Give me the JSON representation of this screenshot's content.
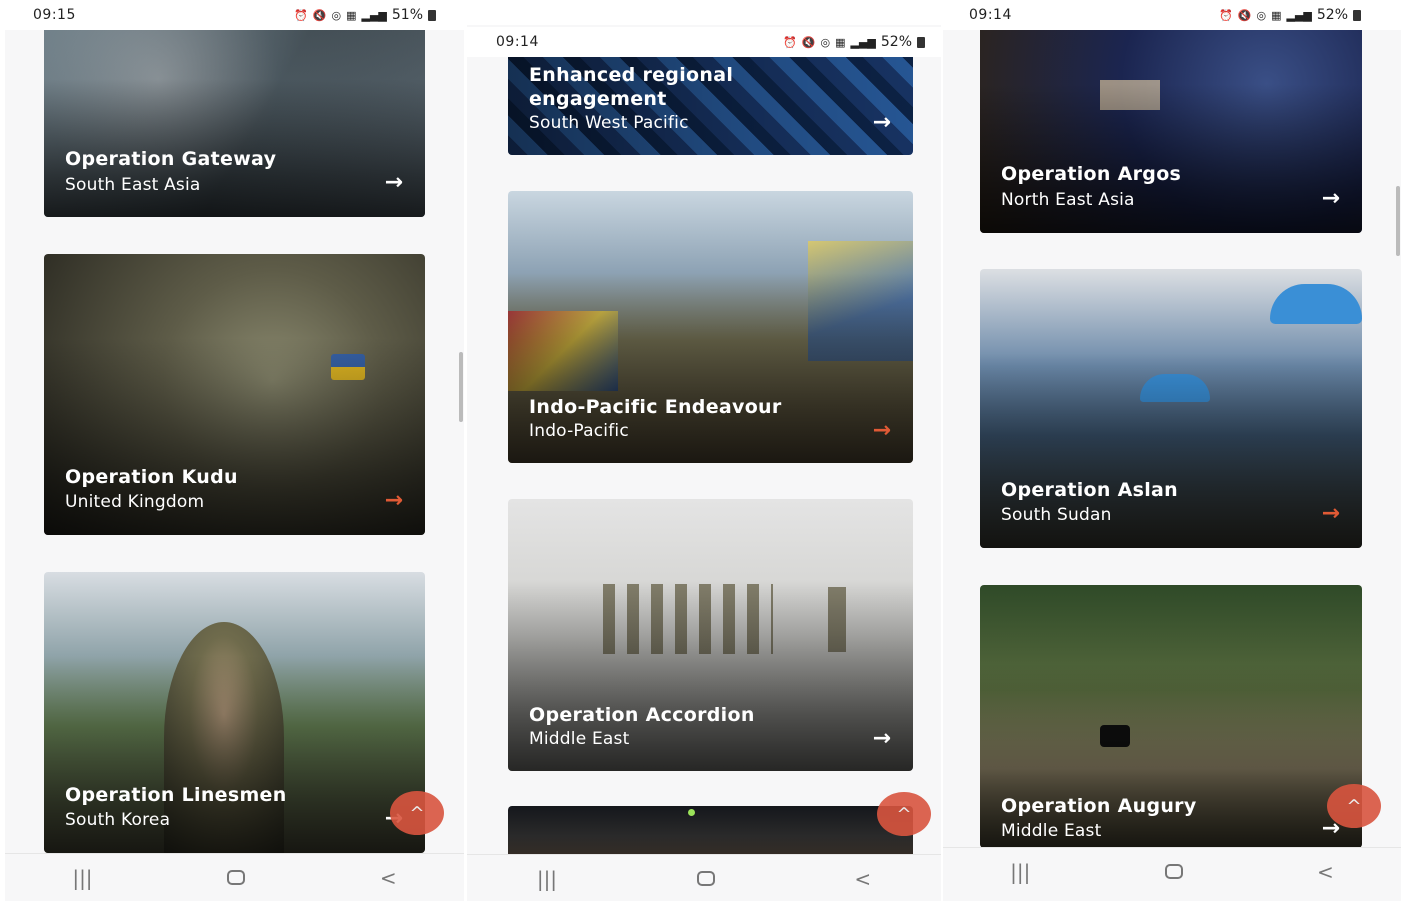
{
  "screens": [
    {
      "status": {
        "time": "09:15",
        "battery": "51%"
      },
      "cards": [
        {
          "title": "Operation Gateway",
          "subtitle": "South East Asia"
        },
        {
          "title": "Operation Kudu",
          "subtitle": "United Kingdom"
        },
        {
          "title": "Operation Linesmen",
          "subtitle": "South Korea"
        }
      ]
    },
    {
      "status": {
        "time": "09:14",
        "battery": "52%"
      },
      "cards": [
        {
          "title": "Enhanced regional engagement",
          "subtitle": "South West Pacific"
        },
        {
          "title": "Indo-Pacific Endeavour",
          "subtitle": "Indo-Pacific"
        },
        {
          "title": "Operation Accordion",
          "subtitle": "Middle East"
        }
      ]
    },
    {
      "status": {
        "time": "09:14",
        "battery": "52%"
      },
      "cards": [
        {
          "title": "Operation Argos",
          "subtitle": "North East Asia"
        },
        {
          "title": "Operation Aslan",
          "subtitle": "South Sudan"
        },
        {
          "title": "Operation Augury",
          "subtitle": "Middle East"
        }
      ]
    }
  ],
  "icons": {
    "arrow": "→",
    "fab": "^",
    "nav_recent": "|||",
    "nav_back": "<"
  },
  "colors": {
    "accent": "#d9553f",
    "arrow_highlight": "#e05a35"
  }
}
